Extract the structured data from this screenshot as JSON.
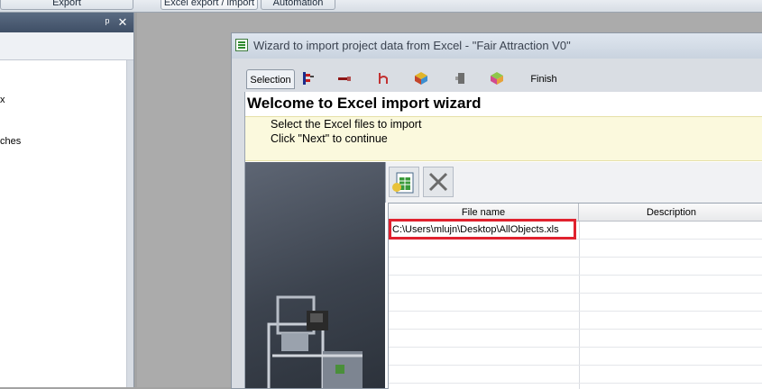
{
  "ribbon": {
    "tabs": [
      "Export",
      "Excel export / import",
      "Automation"
    ]
  },
  "panel": {
    "pin_glyph": "ᵖ",
    "close_glyph": "✕",
    "text_fragments": [
      "x",
      "ches"
    ]
  },
  "dialog": {
    "title": "Wizard to import project data from Excel - \"Fair Attraction V0\"",
    "tabs": {
      "selection": "Selection",
      "finish": "Finish"
    },
    "heading": "Welcome to Excel import wizard",
    "info_lines": [
      "Select the Excel files to import",
      "Click \"Next\" to continue"
    ],
    "grid": {
      "columns": [
        "File name",
        "Description"
      ],
      "rows": [
        {
          "file": "C:\\Users\\mlujn\\Desktop\\AllObjects.xls",
          "description": ""
        }
      ]
    }
  },
  "colors": {
    "highlight": "#e0212e",
    "info_background": "#fbf9dd",
    "panel_header": "#3f4f66"
  },
  "icons": [
    "excel-icon",
    "wiring-icon",
    "cable-icon",
    "connector-icon",
    "module-icon",
    "device-icon",
    "cube-icon",
    "add-file-icon",
    "delete-icon"
  ]
}
